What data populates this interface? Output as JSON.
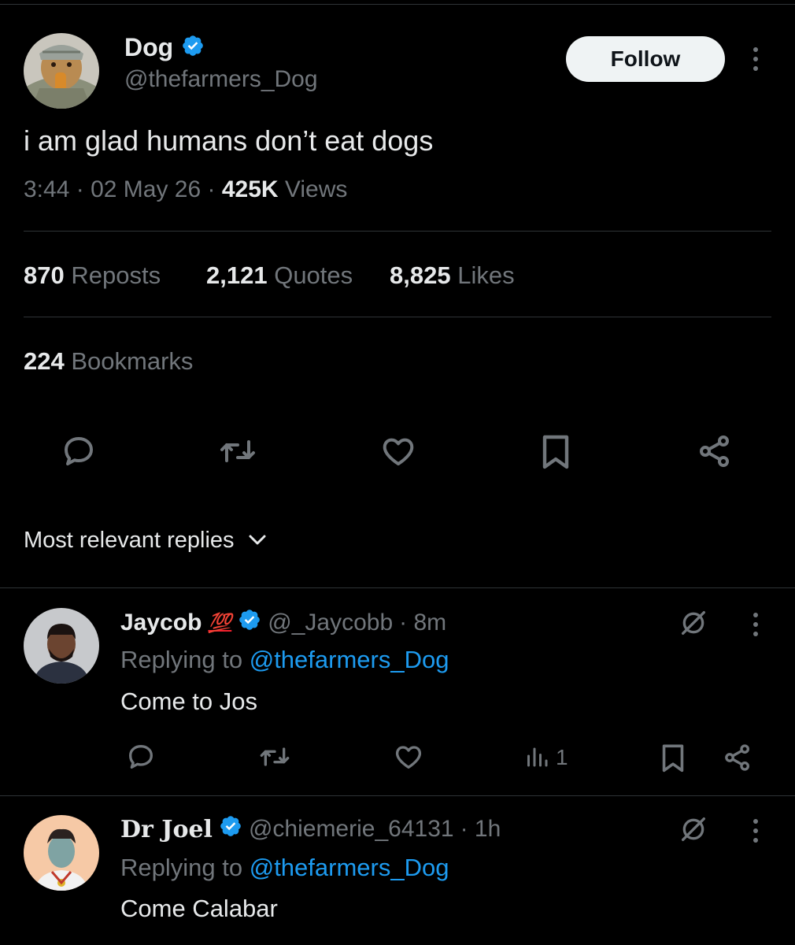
{
  "tweet": {
    "author_name": "Dog",
    "author_handle": "@thefarmers_Dog",
    "follow_label": "Follow",
    "text": "i am glad humans don’t eat dogs",
    "time": "3:44",
    "date": "02 May 26",
    "views_count": "425K",
    "views_label": "Views",
    "separator": "·",
    "stats": {
      "reposts_count": "870",
      "reposts_label": "Reposts",
      "quotes_count": "2,121",
      "quotes_label": "Quotes",
      "likes_count": "8,825",
      "likes_label": "Likes",
      "bookmarks_count": "224",
      "bookmarks_label": "Bookmarks"
    },
    "actions": [
      "reply-icon",
      "repost-icon",
      "like-icon",
      "bookmark-icon",
      "share-icon"
    ]
  },
  "sort": {
    "label": "Most relevant replies"
  },
  "replies": [
    {
      "name": "Jaycob",
      "emoji": "💯",
      "handle": "@_Jaycobb",
      "age": "· 8m",
      "replying_prefix": "Replying to",
      "replying_to": "@thefarmers_Dog",
      "text": "Come to Jos",
      "views_count": "1"
    },
    {
      "name": "Dr Joel",
      "handle": "@chiemerie_64131",
      "age": "· 1h",
      "replying_prefix": "Replying to",
      "replying_to": "@thefarmers_Dog",
      "text": "Come Calabar"
    }
  ],
  "colors": {
    "background": "#000000",
    "text_primary": "#e7e9ea",
    "text_secondary": "#71767b",
    "link": "#1d9bf0",
    "verified": "#1d9bf0",
    "divider": "#2f3336"
  }
}
